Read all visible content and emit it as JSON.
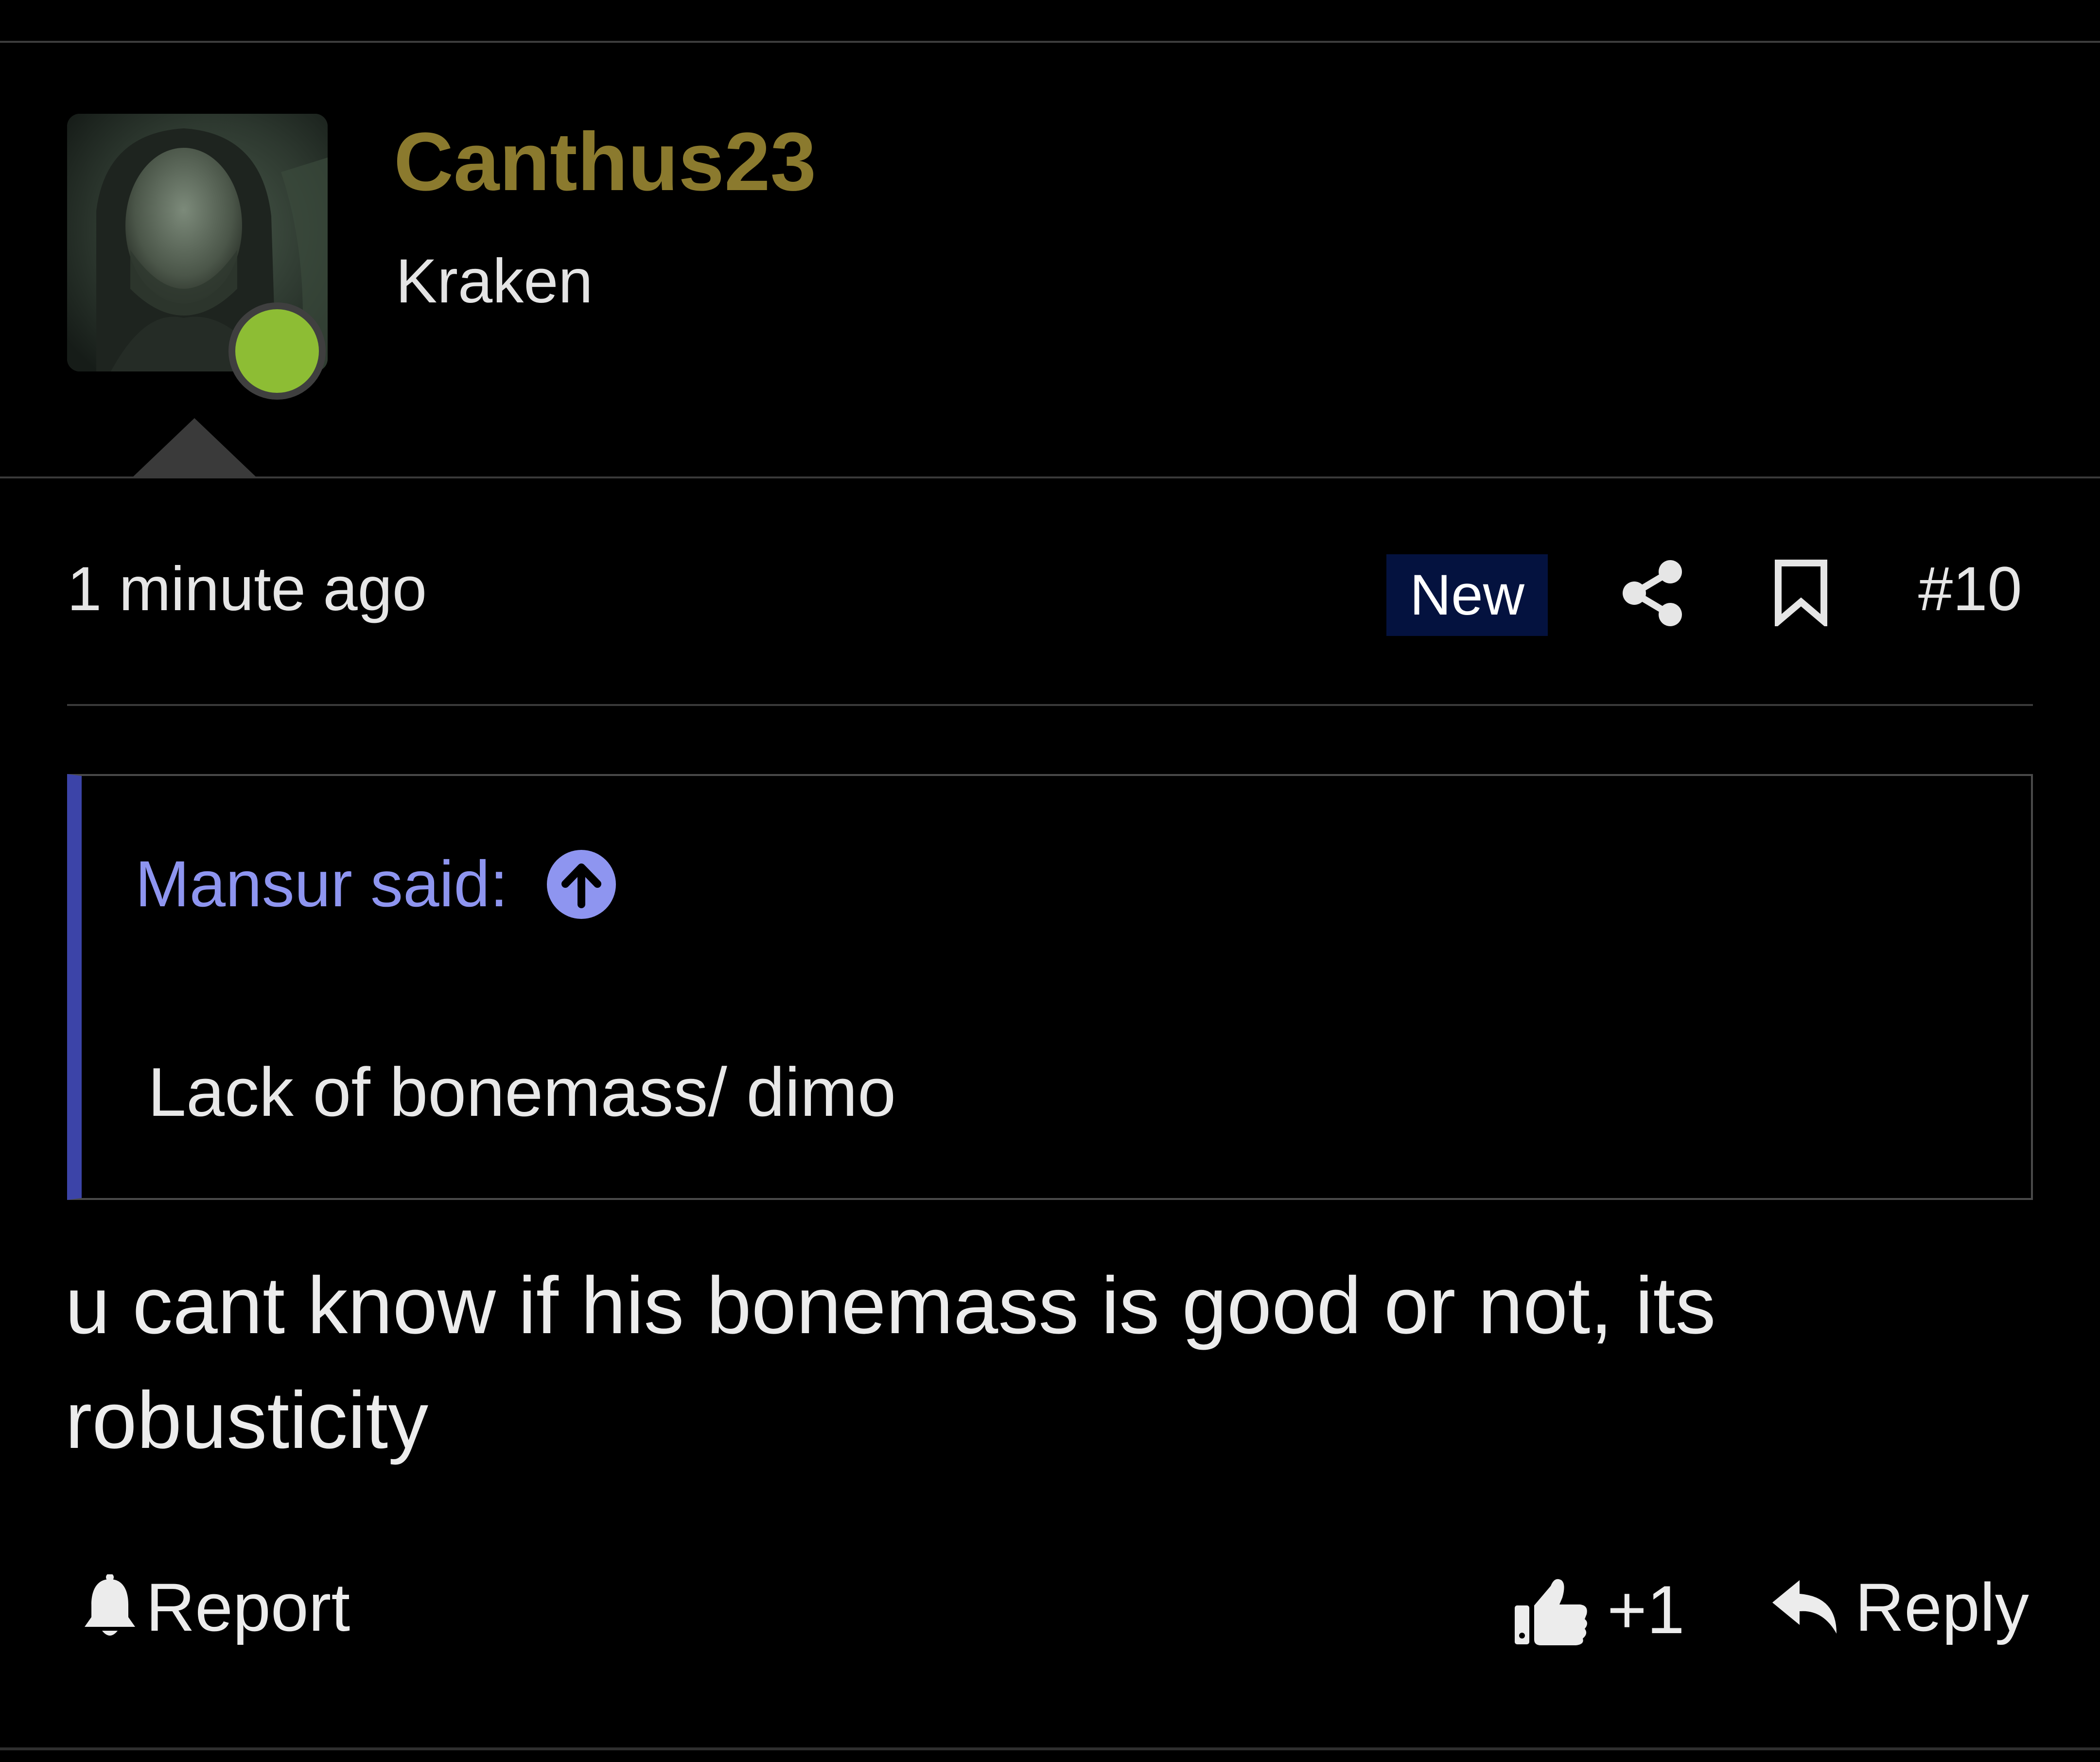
{
  "post": {
    "author": {
      "username": "Canthus23",
      "user_title": "Kraken",
      "online": true,
      "username_color": "#8b7a2e",
      "status_color": "#8dbd34"
    },
    "meta": {
      "timestamp": "1 minute ago",
      "new_badge": "New",
      "post_number": "#10",
      "icons": [
        "share-icon",
        "bookmark-icon"
      ]
    },
    "quote": {
      "author_line": "Mansur said:",
      "body": "Lack of bonemass/ dimo",
      "accent_color": "#3c44a8",
      "icon": "arrow-up-circle-icon"
    },
    "message": "u cant know if his bonemass is good or not, its robusticity",
    "actions": {
      "report_label": "Report",
      "reaction_count": "+1",
      "reply_label": "Reply",
      "icons": [
        "bell-icon",
        "thumbs-up-icon",
        "reply-arrow-icon"
      ]
    }
  }
}
